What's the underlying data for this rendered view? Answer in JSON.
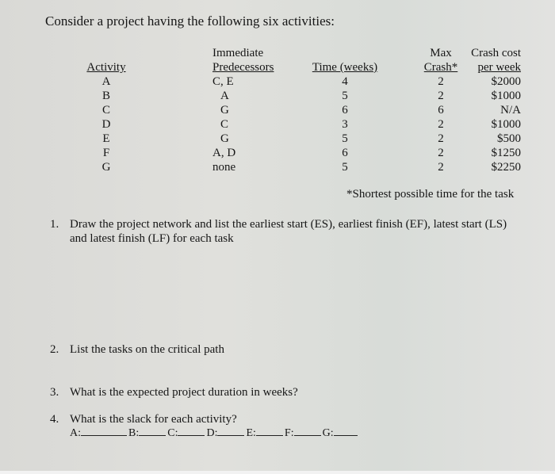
{
  "intro": "Consider a project having the following six activities:",
  "table": {
    "headers": {
      "activity": [
        "",
        "Activity"
      ],
      "predecessors": [
        "Immediate",
        "Predecessors"
      ],
      "time": [
        "",
        "Time (weeks)"
      ],
      "max_crash": [
        "Max",
        "Crash*"
      ],
      "crash_cost": [
        "Crash cost",
        "per week"
      ]
    },
    "rows": [
      {
        "activity": "A",
        "predecessors": "C, E",
        "time": "4",
        "max_crash": "2",
        "crash_cost": "$2000"
      },
      {
        "activity": "B",
        "predecessors": "A",
        "time": "5",
        "max_crash": "2",
        "crash_cost": "$1000"
      },
      {
        "activity": "C",
        "predecessors": "G",
        "time": "6",
        "max_crash": "6",
        "crash_cost": "N/A"
      },
      {
        "activity": "D",
        "predecessors": "C",
        "time": "3",
        "max_crash": "2",
        "crash_cost": "$1000"
      },
      {
        "activity": "E",
        "predecessors": "G",
        "time": "5",
        "max_crash": "2",
        "crash_cost": "$500"
      },
      {
        "activity": "F",
        "predecessors": "A, D",
        "time": "6",
        "max_crash": "2",
        "crash_cost": "$1250"
      },
      {
        "activity": "G",
        "predecessors": "none",
        "time": "5",
        "max_crash": "2",
        "crash_cost": "$2250"
      }
    ]
  },
  "footnote": "*Shortest possible time for the task",
  "questions": [
    {
      "num": "1.",
      "lines": [
        "Draw the project network and list the earliest start (ES), earliest finish (EF), latest start (LS)",
        "and latest finish (LF) for each task"
      ]
    },
    {
      "num": "2.",
      "lines": [
        "List the tasks on the critical path"
      ]
    },
    {
      "num": "3.",
      "lines": [
        "What is the expected project duration in weeks?"
      ]
    },
    {
      "num": "4.",
      "lines": [
        "What is the slack for each activity?"
      ]
    }
  ],
  "slack_labels": [
    "A:",
    "B:",
    "C:",
    "D:",
    "E:",
    "F:",
    "G:"
  ]
}
